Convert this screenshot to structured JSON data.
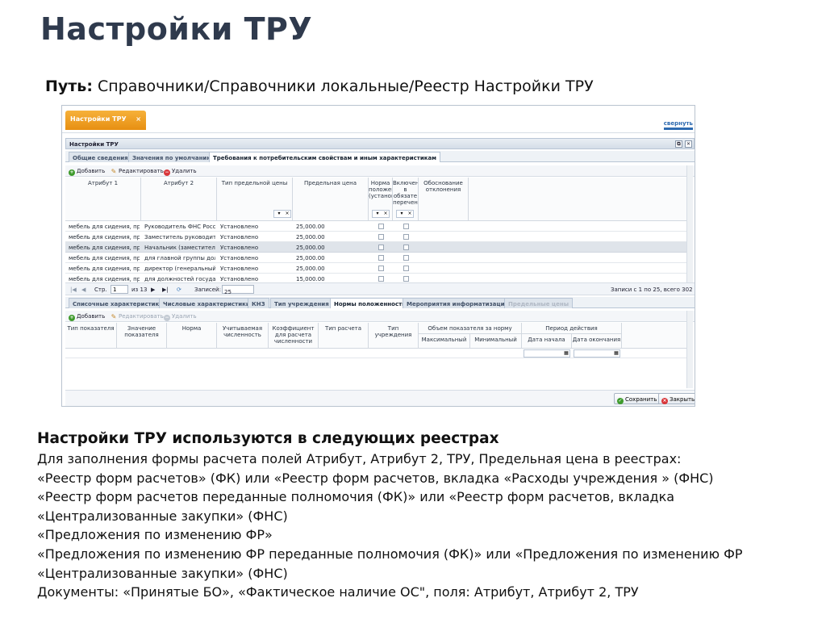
{
  "slide": {
    "title": "Настройки ТРУ",
    "path_label": "Путь:",
    "path_value": "Справочники/Справочники локальные/Реестр Настройки ТРУ"
  },
  "app": {
    "tab_label": "Настройки ТРУ",
    "tab_close": "×",
    "collapse": "свернуть",
    "window_title": "Настройки ТРУ",
    "window_ctl_restore": "⧉",
    "window_ctl_close": "✕"
  },
  "top_tabs": [
    {
      "label": "Общие сведения"
    },
    {
      "label": "Значения по умолчанию"
    },
    {
      "label": "Требования к потребительским свойствам и иным характеристикам"
    }
  ],
  "toolbar1": {
    "add": "Добавить",
    "edit": "Редактировать",
    "delete": "Удалить"
  },
  "grid1": {
    "headers": [
      "Атрибут 1",
      "Атрибут 2",
      "Тип предельной цены",
      "Предельная цена",
      "Норма положен (установ",
      "Включен в обязате перечен",
      "Обоснование отклонения"
    ],
    "rows": [
      [
        "мебель для сидения, пре...",
        "Руководитель ФНС России",
        "Установлено",
        "25,000.00"
      ],
      [
        "мебель для сидения, пре...",
        "Заместитель руководите...",
        "Установлено",
        "25,000.00"
      ],
      [
        "мебель для сидения, пре...",
        "Начальник (заместитель ...",
        "Установлено",
        "25,000.00"
      ],
      [
        "мебель для сидения, пре...",
        "для главной группы дол...",
        "Установлено",
        "25,000.00"
      ],
      [
        "мебель для сидения, пре...",
        "директор (генеральный ...",
        "Установлено",
        "25,000.00"
      ],
      [
        "мебель для сидения, пре...",
        "для должностей государ...",
        "Установлено",
        "15,000.00"
      ]
    ]
  },
  "pager": {
    "page_label": "Стр.",
    "page_value": "1",
    "of_label": "из 13",
    "records_label": "Записей:",
    "records_value": "25",
    "summary": "Записи с 1 по 25, всего 302"
  },
  "bottom_tabs": [
    {
      "label": "Списочные характеристики"
    },
    {
      "label": "Числовые характеристики"
    },
    {
      "label": "КНЗ"
    },
    {
      "label": "Тип учреждения"
    },
    {
      "label": "Нормы положенности"
    },
    {
      "label": "Мероприятия информатизации"
    },
    {
      "label": "Предельные цены"
    }
  ],
  "toolbar2": {
    "add": "Добавить",
    "edit": "Редактировать",
    "delete": "Удалить"
  },
  "grid2": {
    "headers": [
      "Тип показателя",
      "Значение показателя",
      "Норма",
      "Учитываемая численность",
      "Коэффициент для расчета численности",
      "Тип расчета",
      "Тип учреждения"
    ],
    "group_volume": "Объем показателя за норму",
    "group_period": "Период действия",
    "sub_headers": [
      "Максимальный",
      "Минимальный",
      "Дата начала",
      "Дата окончания"
    ]
  },
  "footer": {
    "save": "Сохранить",
    "close": "Закрыть"
  },
  "description": {
    "heading": "Настройки ТРУ используются в следующих реестрах",
    "lines": [
      "Для заполнения  формы расчета полей Атрибут, Атрибут 2, ТРУ, Предельная цена  в реестрах:",
      "«Реестр форм расчетов» (ФК) или «Реестр форм расчетов, вкладка  «Расходы учреждения » (ФНС)",
      "«Реестр форм расчетов  переданные полномочия (ФК)» или «Реестр форм расчетов, вкладка",
      "«Централизованные закупки» (ФНС)",
      "«Предложения по изменению ФР»",
      "«Предложения по изменению ФР переданные полномочия (ФК)» или «Предложения по изменению ФР",
      "«Централизованные закупки» (ФНС)",
      "Документы: «Принятые БО», «Фактическое наличие ОС\", поля: Атрибут, Атрибут 2, ТРУ"
    ]
  },
  "colors": {
    "accent_tab": "#e78f12",
    "title": "#2f3a4d",
    "add": "#3f9b2d",
    "delete": "#d9363a"
  }
}
